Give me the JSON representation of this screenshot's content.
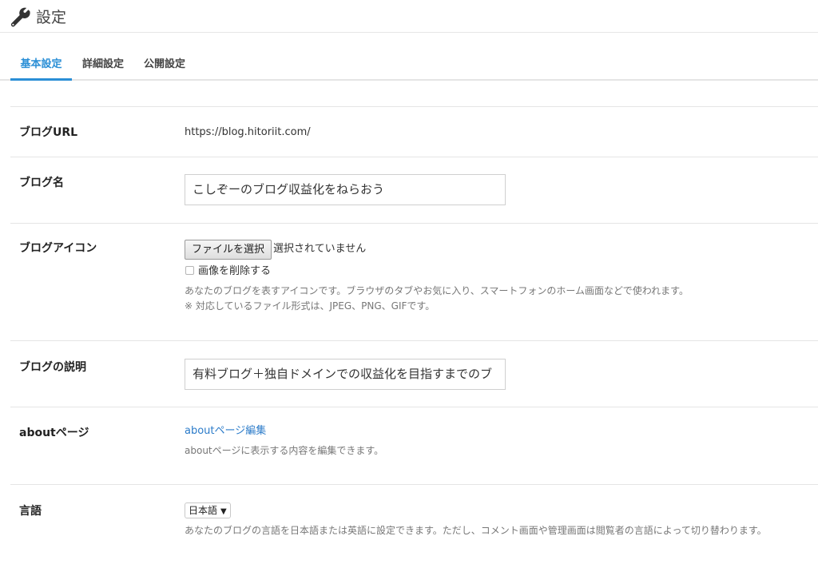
{
  "header": {
    "icon": "wrench-icon",
    "title": "設定"
  },
  "tabs": [
    {
      "label": "基本設定",
      "active": true
    },
    {
      "label": "詳細設定",
      "active": false
    },
    {
      "label": "公開設定",
      "active": false
    }
  ],
  "rows": {
    "blog_url": {
      "label": "ブログURL",
      "value": "https://blog.hitoriit.com/"
    },
    "blog_name": {
      "label": "ブログ名",
      "value": "こしぞーのブログ収益化をねらおう"
    },
    "blog_icon": {
      "label": "ブログアイコン",
      "file_button": "ファイルを選択",
      "file_status": "選択されていません",
      "delete_checkbox_label": "画像を削除する",
      "delete_checked": false,
      "help_1": "あなたのブログを表すアイコンです。ブラウザのタブやお気に入り、スマートフォンのホーム画面などで使われます。",
      "help_2": "※ 対応しているファイル形式は、JPEG、PNG、GIFです。"
    },
    "blog_description": {
      "label": "ブログの説明",
      "value": "有料ブログ＋独自ドメインでの収益化を目指すまでのブ"
    },
    "about_page": {
      "label": "aboutページ",
      "link": "aboutページ編集",
      "help": "aboutページに表示する内容を編集できます。"
    },
    "language": {
      "label": "言語",
      "selected": "日本語",
      "help": "あなたのブログの言語を日本語または英語に設定できます。ただし、コメント画面や管理画面は閲覧者の言語によって切り替わります。"
    }
  },
  "colors": {
    "accent": "#2b8fd6",
    "link": "#2b7bc9",
    "divider": "#e5e5e5",
    "help_text": "#777777"
  }
}
